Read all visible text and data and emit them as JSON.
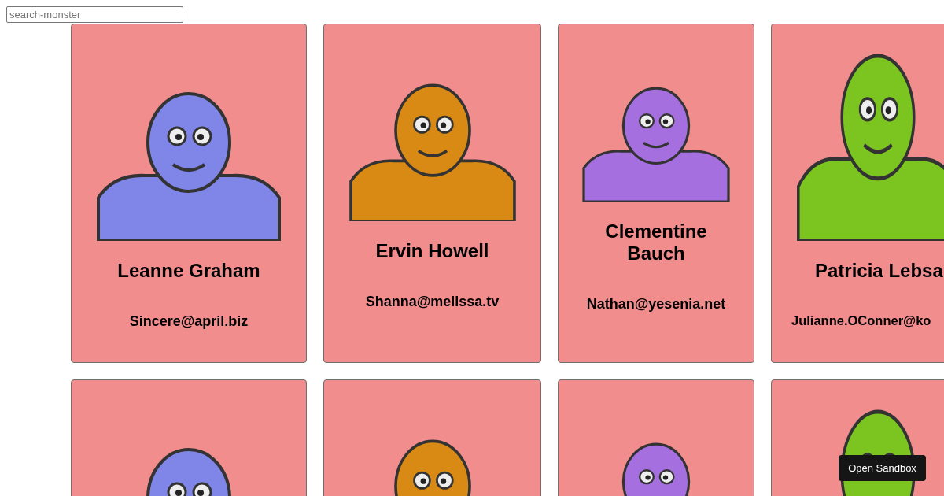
{
  "search": {
    "placeholder": "search-monster"
  },
  "cards": [
    {
      "kind": "full",
      "name": "Leanne Graham",
      "email": "Sincere@april.biz"
    },
    {
      "kind": "full",
      "name": "Ervin Howell",
      "email": "Shanna@melissa.tv"
    },
    {
      "kind": "full",
      "name": "Clementine Bauch",
      "email": "Nathan@yesenia.net"
    },
    {
      "kind": "full",
      "name": "Patricia Lebsa",
      "email": "Julianne.OConner@ko"
    },
    {
      "kind": "image-only"
    },
    {
      "kind": "image-only"
    },
    {
      "kind": "image-only"
    },
    {
      "kind": "image-only"
    }
  ],
  "sandbox_button": {
    "label": "Open Sandbox"
  }
}
